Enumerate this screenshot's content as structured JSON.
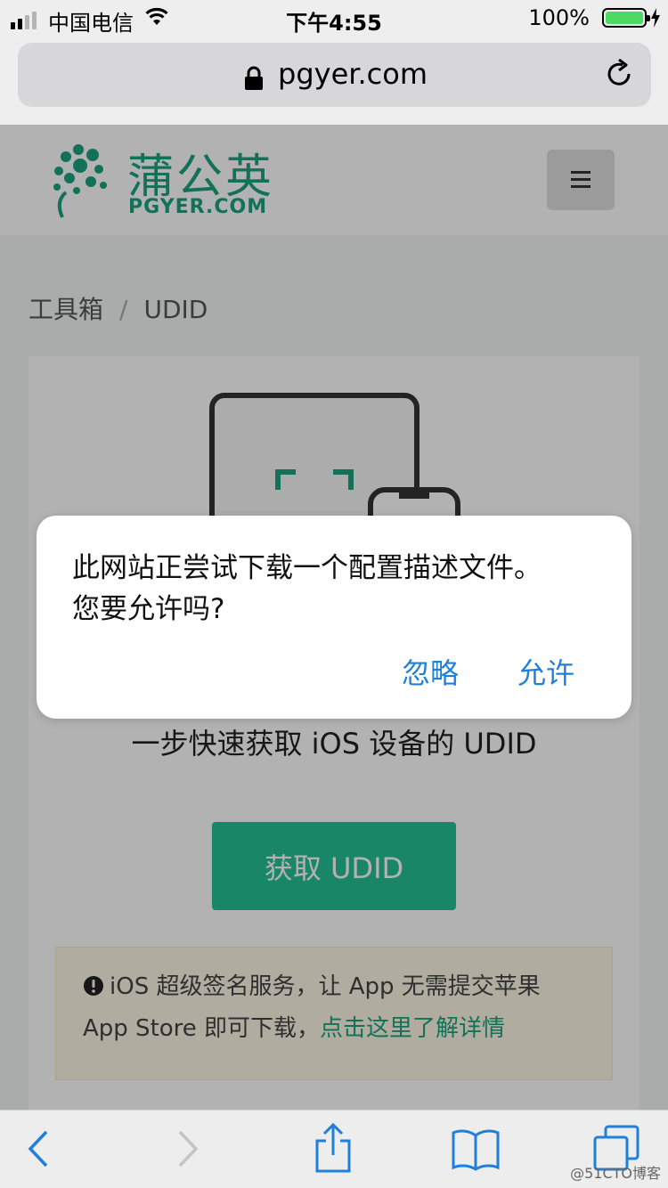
{
  "status_bar": {
    "carrier": "中国电信",
    "time": "下午4:55",
    "battery_percent": "100%",
    "battery_level": 1.0,
    "signal_bars_active": 2,
    "signal_bars_total": 4
  },
  "browser": {
    "url": "pgyer.com"
  },
  "site": {
    "logo_cn": "蒲公英",
    "logo_en": "PGYER.COM",
    "brand_color": "#1aa27e"
  },
  "breadcrumb": {
    "items": [
      "工具箱",
      "UDID"
    ],
    "separator": "/"
  },
  "card": {
    "subtitle": "一步快速获取 iOS 设备的 UDID",
    "button_label": "获取 UDID",
    "button_color": "#24c196",
    "notice_text": "iOS 超级签名服务，让 App 无需提交苹果 App Store 即可下载，",
    "notice_link": "点击这里了解详情"
  },
  "alert": {
    "message_line1": "此网站正尝试下载一个配置描述文件。",
    "message_line2": "您要允许吗?",
    "ignore_label": "忽略",
    "allow_label": "允许",
    "action_color": "#1f7fd9"
  },
  "toolbar": {
    "icons": [
      "back-icon",
      "forward-icon",
      "share-icon",
      "bookmarks-icon",
      "tabs-icon"
    ]
  },
  "watermark": "@51CTO博客"
}
